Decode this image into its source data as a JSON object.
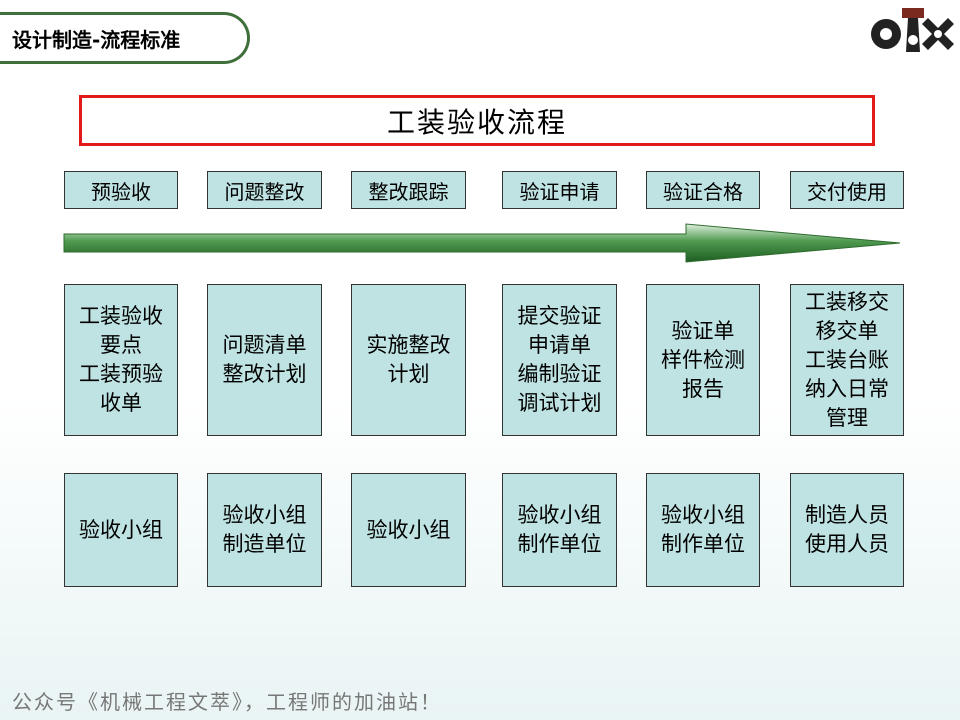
{
  "header": {
    "title": "设计制造-流程标准"
  },
  "logo": {
    "icon": "company-logo-icon"
  },
  "flow_title": "工装验收流程",
  "stages": [
    "预验收",
    "问题整改",
    "整改跟踪",
    "验证申请",
    "验证合格",
    "交付使用"
  ],
  "details": [
    "工装验收\n要点\n工装预验\n收单",
    "问题清单\n整改计划",
    "实施整改\n计划",
    "提交验证\n申请单\n编制验证\n调试计划",
    "验证单\n样件检测\n报告",
    "工装移交\n移交单\n工装台账\n纳入日常\n管理"
  ],
  "owners": [
    "验收小组",
    "验收小组\n制造单位",
    "验收小组",
    "验收小组\n制作单位",
    "验收小组\n制作单位",
    "制造人员\n使用人员"
  ],
  "footer": "公众号《机械工程文萃》，工程师的加油站！",
  "colors": {
    "box_fill": "#bfe3e3",
    "title_border": "#e21a1a",
    "arrow": "#2e7d32",
    "header_border": "#3f6f3a"
  }
}
